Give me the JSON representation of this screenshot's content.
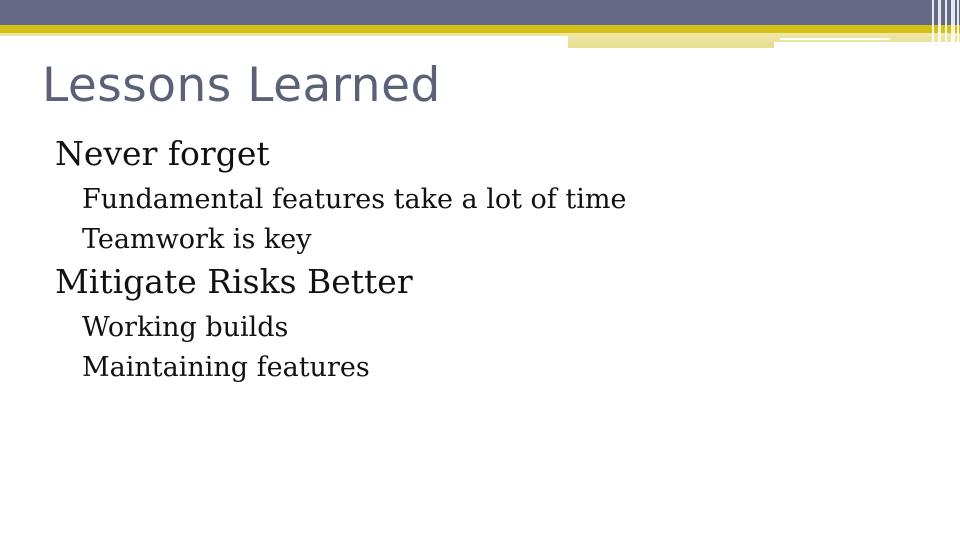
{
  "slide": {
    "title": "Lessons Learned",
    "sections": [
      {
        "heading": "Never forget",
        "items": [
          "Fundamental features take a lot of time",
          "Teamwork is key"
        ]
      },
      {
        "heading": "Mitigate Risks Better",
        "items": [
          "Working builds",
          "Maintaining features"
        ]
      }
    ]
  },
  "colors": {
    "header_slate": "#646a86",
    "header_gold": "#d4c018",
    "title_text": "#5b6278",
    "body_text": "#111111"
  }
}
